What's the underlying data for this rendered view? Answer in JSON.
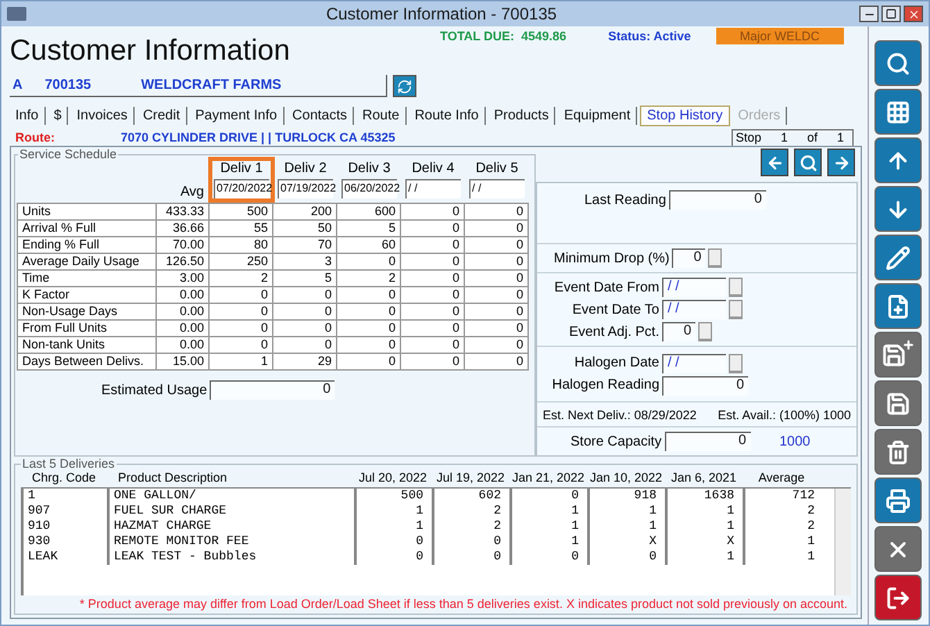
{
  "window": {
    "title": "Customer Information - 700135"
  },
  "header": {
    "title": "Customer Information",
    "total_due_label": "TOTAL DUE:",
    "total_due": "4549.86",
    "status": "Status: Active",
    "badge": "Major WELDC"
  },
  "account": {
    "type": "A",
    "number": "700135",
    "name": "WELDCRAFT FARMS"
  },
  "tabs": [
    {
      "label": "Info",
      "selected": false,
      "disabled": false
    },
    {
      "label": "$",
      "selected": false,
      "disabled": false
    },
    {
      "label": "Invoices",
      "selected": false,
      "disabled": false
    },
    {
      "label": "Credit",
      "selected": false,
      "disabled": false
    },
    {
      "label": "Payment Info",
      "selected": false,
      "disabled": false
    },
    {
      "label": "Contacts",
      "selected": false,
      "disabled": false
    },
    {
      "label": "Route",
      "selected": false,
      "disabled": false
    },
    {
      "label": "Route Info",
      "selected": false,
      "disabled": false
    },
    {
      "label": "Products",
      "selected": false,
      "disabled": false
    },
    {
      "label": "Equipment",
      "selected": false,
      "disabled": false
    },
    {
      "label": "Stop History",
      "selected": true,
      "disabled": false
    },
    {
      "label": "Orders",
      "selected": false,
      "disabled": true
    }
  ],
  "route": {
    "label": "Route:",
    "address": "7070 CYLINDER DRIVE |  | TURLOCK CA 45325"
  },
  "stop": {
    "label": "Stop",
    "current": "1",
    "of": "of",
    "total": "1"
  },
  "service_schedule": {
    "title": "Service Schedule",
    "avg_label": "Avg",
    "columns": [
      {
        "label": "Deliv 1",
        "date": "07/20/2022",
        "highlighted": true
      },
      {
        "label": "Deliv 2",
        "date": "07/19/2022",
        "highlighted": false
      },
      {
        "label": "Deliv 3",
        "date": "06/20/2022",
        "highlighted": false
      },
      {
        "label": "Deliv 4",
        "date": "/ /",
        "highlighted": false
      },
      {
        "label": "Deliv 5",
        "date": "/ /",
        "highlighted": false
      }
    ],
    "rows": [
      {
        "label": "Units",
        "avg": "433.33",
        "values": [
          "500",
          "200",
          "600",
          "0",
          "0"
        ]
      },
      {
        "label": "Arrival % Full",
        "avg": "36.66",
        "values": [
          "55",
          "50",
          "5",
          "0",
          "0"
        ]
      },
      {
        "label": "Ending % Full",
        "avg": "70.00",
        "values": [
          "80",
          "70",
          "60",
          "0",
          "0"
        ]
      },
      {
        "label": "Average Daily Usage",
        "avg": "126.50",
        "values": [
          "250",
          "3",
          "0",
          "0",
          "0"
        ]
      },
      {
        "label": "Time",
        "avg": "3.00",
        "values": [
          "2",
          "5",
          "2",
          "0",
          "0"
        ]
      },
      {
        "label": "K Factor",
        "avg": "0.00",
        "values": [
          "0",
          "0",
          "0",
          "0",
          "0"
        ]
      },
      {
        "label": "Non-Usage Days",
        "avg": "0.00",
        "values": [
          "0",
          "0",
          "0",
          "0",
          "0"
        ]
      },
      {
        "label": "From Full Units",
        "avg": "0.00",
        "values": [
          "0",
          "0",
          "0",
          "0",
          "0"
        ]
      },
      {
        "label": "Non-tank Units",
        "avg": "0.00",
        "values": [
          "0",
          "0",
          "0",
          "0",
          "0"
        ]
      },
      {
        "label": "Days Between Delivs.",
        "avg": "15.00",
        "values": [
          "1",
          "29",
          "0",
          "0",
          "0"
        ]
      }
    ],
    "estimated_usage": {
      "label": "Estimated Usage",
      "value": "0"
    }
  },
  "readings": {
    "last_reading": {
      "label": "Last Reading",
      "value": "0"
    },
    "minimum_drop": {
      "label": "Minimum Drop (%)",
      "value": "0"
    },
    "event_date_from": {
      "label": "Event Date From",
      "value": "/ /"
    },
    "event_date_to": {
      "label": "Event Date To",
      "value": "/ /"
    },
    "event_adj_pct": {
      "label": "Event Adj. Pct.",
      "value": "0"
    },
    "halogen_date": {
      "label": "Halogen Date",
      "value": "/ /"
    },
    "halogen_reading": {
      "label": "Halogen Reading",
      "value": "0"
    },
    "est_next_deliv": "Est. Next Deliv.: 08/29/2022",
    "est_avail": "Est. Avail.: (100%) 1000",
    "store_capacity": {
      "label": "Store Capacity",
      "value": "0",
      "capacity": "1000"
    }
  },
  "last_deliveries": {
    "title": "Last 5 Deliveries",
    "columns": [
      "Chrg. Code",
      "Product Description",
      "Jul 20, 2022",
      "Jul 19, 2022",
      "Jan 21, 2022",
      "Jan 10, 2022",
      "Jan 6, 2021",
      "Average"
    ],
    "rows": [
      {
        "code": "1",
        "description": "ONE GALLON/",
        "values": [
          "500",
          "602",
          "0",
          "918",
          "1638",
          "712"
        ]
      },
      {
        "code": "907",
        "description": "FUEL SUR CHARGE",
        "values": [
          "1",
          "2",
          "1",
          "1",
          "1",
          "2"
        ]
      },
      {
        "code": "910",
        "description": "HAZMAT CHARGE",
        "values": [
          "1",
          "2",
          "1",
          "1",
          "1",
          "2"
        ]
      },
      {
        "code": "930",
        "description": "REMOTE MONITOR FEE",
        "values": [
          "0",
          "0",
          "1",
          "X",
          "X",
          "1"
        ]
      },
      {
        "code": "LEAK",
        "description": "LEAK TEST - Bubbles",
        "values": [
          "0",
          "0",
          "0",
          "0",
          "1",
          "1"
        ]
      }
    ],
    "footnote": "* Product average may differ from Load Order/Load Sheet if less than 5 deliveries exist. X indicates product not sold previously on account."
  },
  "toolbar": [
    {
      "kind": "search",
      "disabled": false
    },
    {
      "kind": "grid",
      "disabled": false
    },
    {
      "kind": "up",
      "disabled": false
    },
    {
      "kind": "down",
      "disabled": false
    },
    {
      "kind": "edit",
      "disabled": false
    },
    {
      "kind": "new",
      "disabled": false
    },
    {
      "kind": "save-new",
      "disabled": true
    },
    {
      "kind": "save",
      "disabled": true
    },
    {
      "kind": "delete",
      "disabled": true
    },
    {
      "kind": "print",
      "disabled": false
    },
    {
      "kind": "cancel",
      "disabled": true
    },
    {
      "kind": "exit",
      "disabled": false
    }
  ]
}
